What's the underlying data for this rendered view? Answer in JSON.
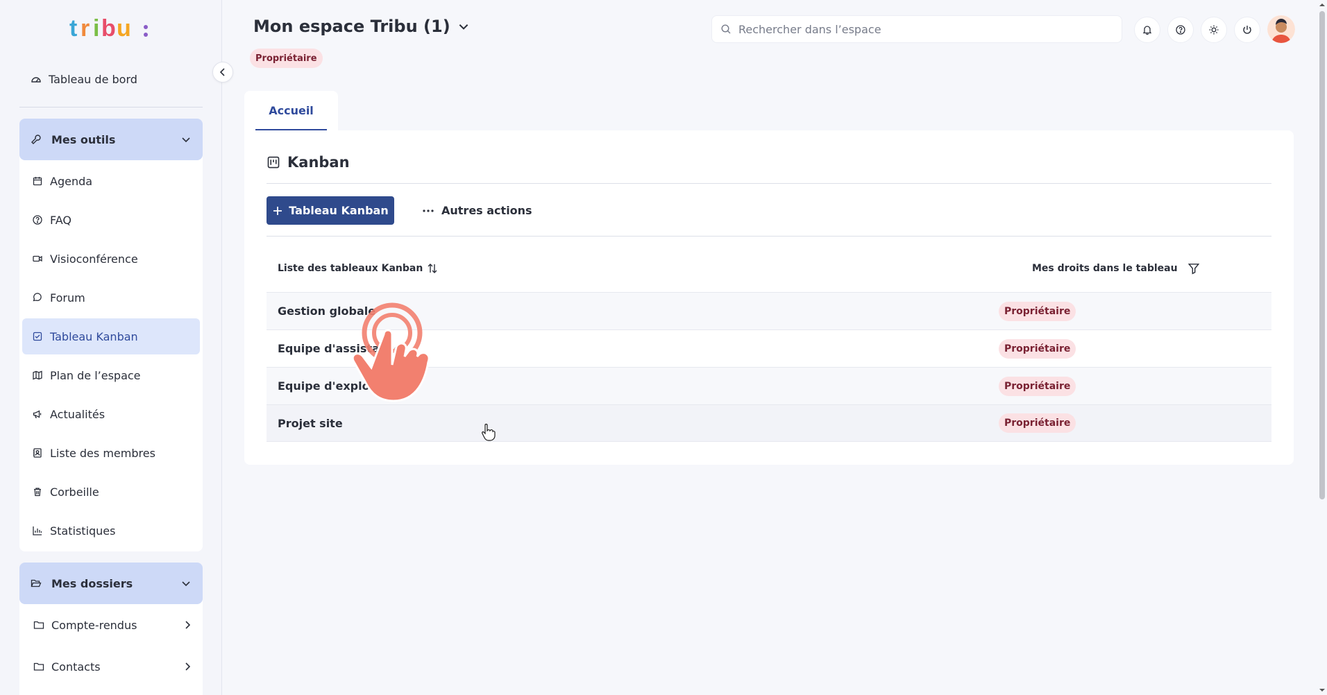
{
  "sidebar": {
    "dashboard_label": "Tableau de bord",
    "tools_group": {
      "label": "Mes outils",
      "items": [
        {
          "label": "Agenda",
          "icon": "calendar-icon"
        },
        {
          "label": "FAQ",
          "icon": "help-circle-icon"
        },
        {
          "label": "Visioconférence",
          "icon": "video-icon"
        },
        {
          "label": "Forum",
          "icon": "chat-icon"
        },
        {
          "label": "Tableau Kanban",
          "icon": "check-square-icon",
          "active": true
        },
        {
          "label": "Plan de l’espace",
          "icon": "map-icon"
        },
        {
          "label": "Actualités",
          "icon": "megaphone-icon"
        },
        {
          "label": "Liste des membres",
          "icon": "contact-icon"
        },
        {
          "label": "Corbeille",
          "icon": "trash-icon"
        },
        {
          "label": "Statistiques",
          "icon": "bar-chart-icon"
        }
      ]
    },
    "folders_group": {
      "label": "Mes dossiers",
      "items": [
        {
          "label": "Compte-rendus"
        },
        {
          "label": "Contacts"
        }
      ]
    }
  },
  "header": {
    "space_title": "Mon espace Tribu (1)",
    "role_badge": "Propriétaire",
    "search_placeholder": "Rechercher dans l’espace"
  },
  "tabs": [
    {
      "label": "Accueil",
      "active": true
    }
  ],
  "kanban": {
    "title": "Kanban",
    "add_button": "Tableau Kanban",
    "more_actions": "Autres actions",
    "columns": {
      "name": "Liste des tableaux Kanban",
      "rights": "Mes droits dans le tableau"
    },
    "rows": [
      {
        "name": "Gestion globale",
        "rights": "Propriétaire"
      },
      {
        "name": "Equipe d'assistance",
        "rights": "Propriétaire"
      },
      {
        "name": "Equipe d'exploitation",
        "rights": "Propriétaire"
      },
      {
        "name": "Projet site",
        "rights": "Propriétaire"
      }
    ]
  },
  "colors": {
    "primary": "#2f4a8c",
    "accent_blue": "#cdd9f7",
    "badge_bg": "#fbe1e4",
    "badge_text": "#7a2233",
    "tap_overlay": "#f2806f"
  }
}
